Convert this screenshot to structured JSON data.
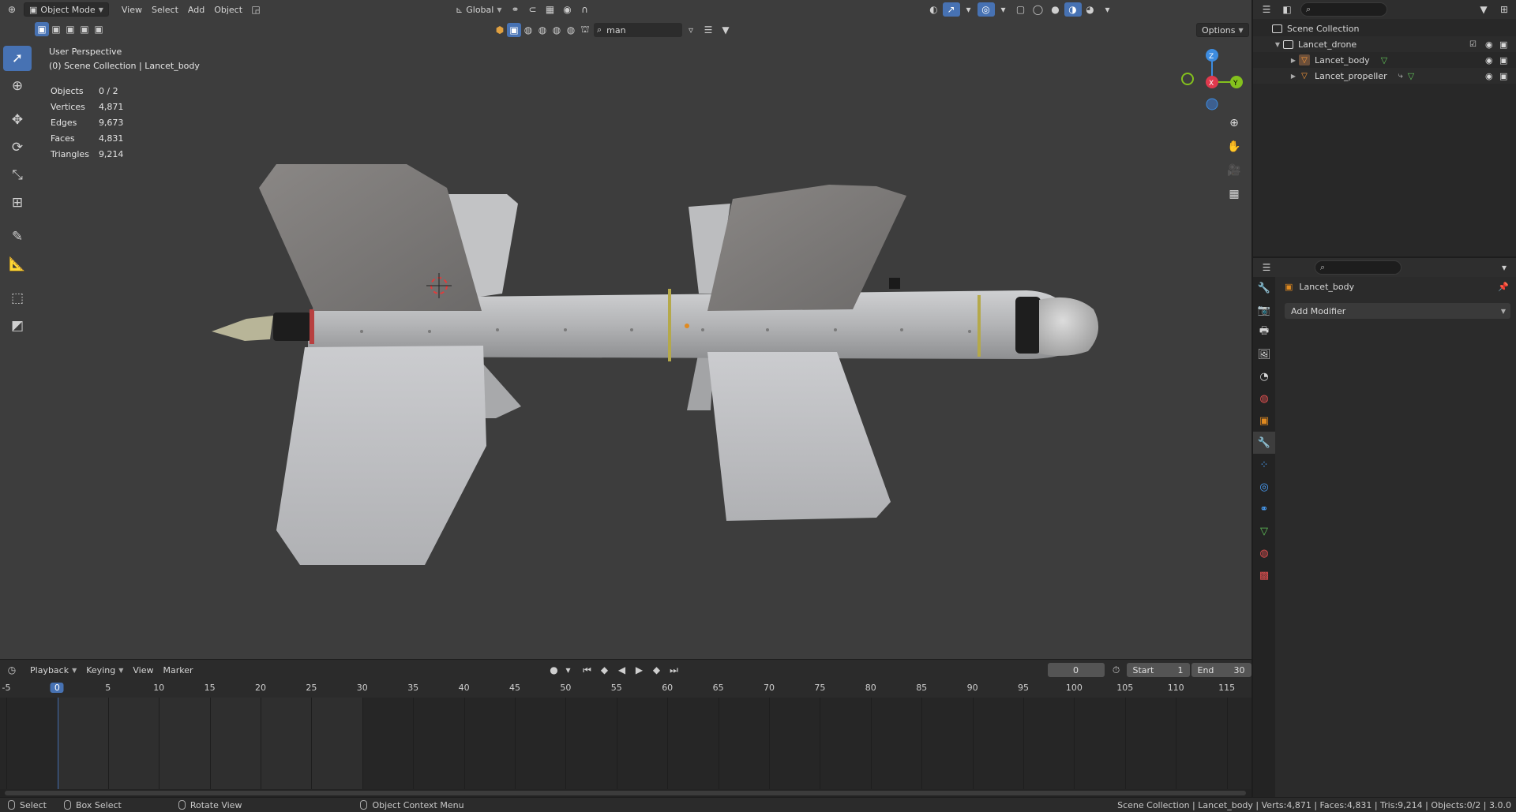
{
  "viewport": {
    "header": {
      "mode": "Object Mode",
      "menus": [
        "View",
        "Select",
        "Add",
        "Object"
      ],
      "transform_orientation": "Global",
      "filter_text": "man",
      "options_label": "Options"
    },
    "overlay": {
      "view_name": "User Perspective",
      "collection_path": "(0) Scene Collection | Lancet_body"
    },
    "stats": {
      "objects_label": "Objects",
      "objects": "0 / 2",
      "vertices_label": "Vertices",
      "vertices": "4,871",
      "edges_label": "Edges",
      "edges": "9,673",
      "faces_label": "Faces",
      "faces": "4,831",
      "triangles_label": "Triangles",
      "triangles": "9,214"
    },
    "gizmo": {
      "z": "Z",
      "x": "X",
      "y": "Y"
    }
  },
  "timeline": {
    "menus": [
      "Playback",
      "Keying",
      "View",
      "Marker"
    ],
    "current_frame": "0",
    "start_label": "Start",
    "start": "1",
    "end_label": "End",
    "end": "30",
    "ticks": [
      "-5",
      "0",
      "5",
      "10",
      "15",
      "20",
      "25",
      "30",
      "35",
      "40",
      "45",
      "50",
      "55",
      "60",
      "65",
      "70",
      "75",
      "80",
      "85",
      "90",
      "95",
      "100",
      "105",
      "110",
      "115"
    ],
    "playhead_label": "0"
  },
  "statusbar": {
    "select": "Select",
    "box_select": "Box Select",
    "rotate_view": "Rotate View",
    "context_menu": "Object Context Menu",
    "info": "Scene Collection | Lancet_body | Verts:4,871 | Faces:4,831 | Tris:9,214 | Objects:0/2 | 3.0.0"
  },
  "outliner": {
    "root": "Scene Collection",
    "collection": "Lancet_drone",
    "objects": [
      "Lancet_body",
      "Lancet_propeller"
    ]
  },
  "properties": {
    "object_name": "Lancet_body",
    "add_modifier": "Add Modifier"
  },
  "colors": {
    "accent": "#4772b3",
    "axis_x": "#e0394d",
    "axis_y": "#84c11d",
    "axis_z": "#3d8ce0"
  }
}
